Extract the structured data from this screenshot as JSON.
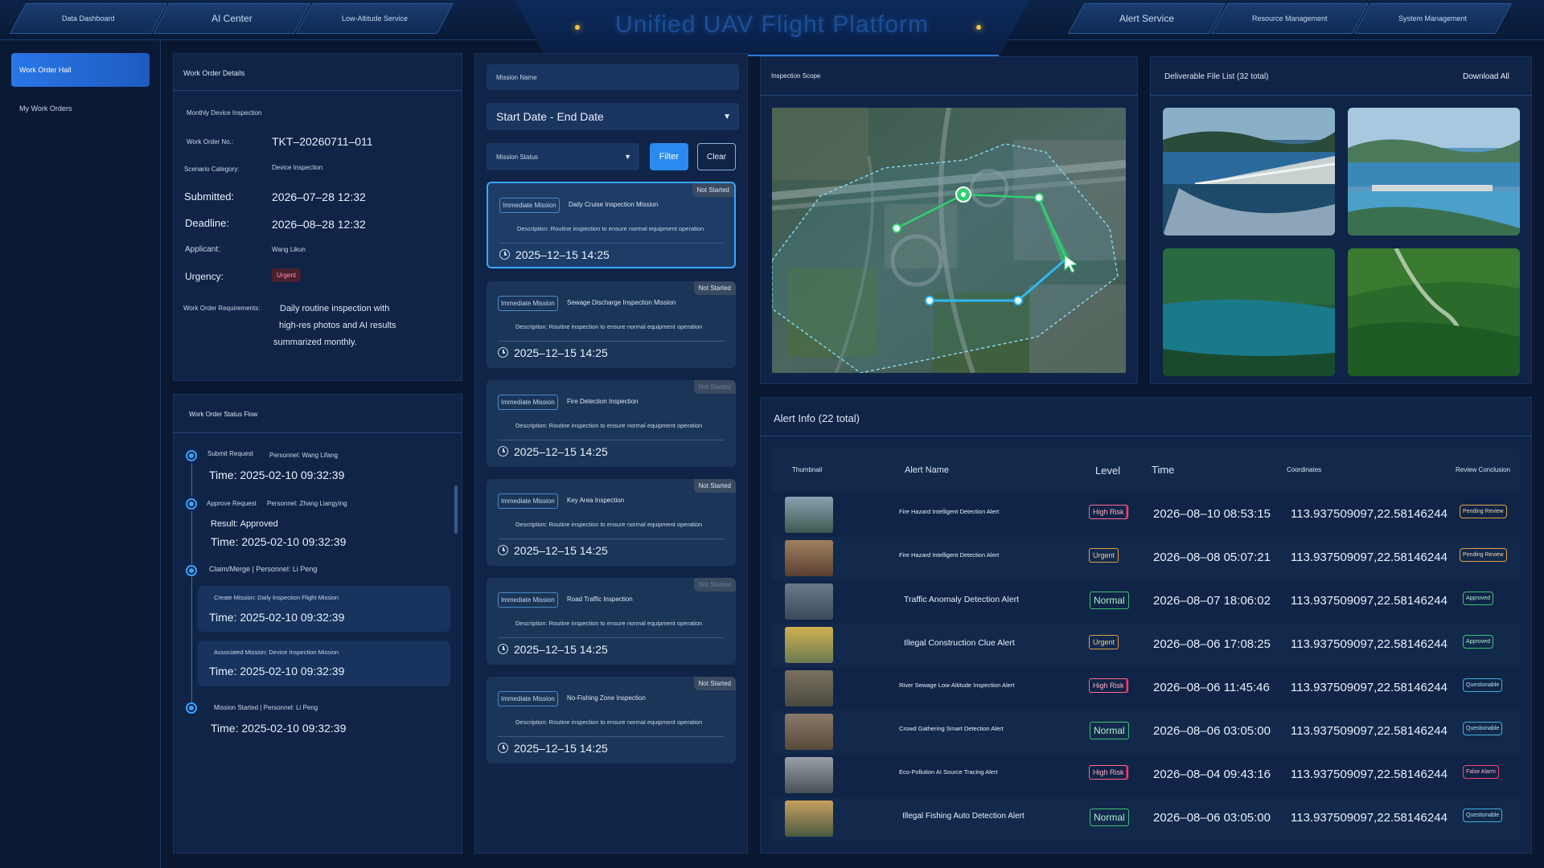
{
  "nav": {
    "left_tabs": [
      "Data Dashboard",
      "AI Center",
      "Low-Altitude Service"
    ],
    "right_tabs": [
      "Alert Service",
      "Resource Management",
      "System Management"
    ],
    "title": "Unified UAV Flight Platform"
  },
  "sidebar": {
    "items": [
      {
        "label": "Work Order Hall",
        "active": true
      },
      {
        "label": "My Work Orders",
        "active": false
      }
    ]
  },
  "work_order": {
    "panel_title": "Work Order Details",
    "name": "Monthly Device Inspection",
    "number_label": "Work Order No.:",
    "number": "TKT–20260711–011",
    "scenario_label": "Scenario Category:",
    "scenario": "Device Inspection",
    "submitted_label": "Submitted:",
    "submitted": "2026–07–28 12:32",
    "deadline_label": "Deadline:",
    "deadline": "2026–08–28 12:32",
    "applicant_label": "Applicant:",
    "applicant": "Wang Likun",
    "urgency_label": "Urgency:",
    "urgency": "Urgent",
    "requirements_label": "Work Order Requirements:",
    "requirements_lines": [
      "Daily routine inspection with",
      "high-res photos and AI results",
      "summarized monthly."
    ]
  },
  "status_flow": {
    "panel_title": "Work Order Status Flow",
    "steps": [
      {
        "title": "Submit Request",
        "personnel": "Personnel: Wang Lifang",
        "time": "Time: 2025-02-10 09:32:39"
      },
      {
        "title": "Approve Request",
        "personnel": "Personnel: Zhang Liangying",
        "result": "Result: Approved",
        "time": "Time: 2025-02-10 09:32:39"
      },
      {
        "title": "Claim/Merge | Personnel: Li Peng",
        "sub": [
          {
            "title": "Create Mission: Daily Inspection Flight Mission",
            "time": "Time: 2025-02-10 09:32:39"
          },
          {
            "title": "Associated Mission: Device Inspection Mission",
            "time": "Time: 2025-02-10 09:32:39"
          }
        ]
      },
      {
        "title": "Mission Started | Personnel: Li Peng",
        "time": "Time: 2025-02-10 09:32:39"
      }
    ]
  },
  "mission_filter": {
    "name_placeholder": "Mission Name",
    "date_range": "Start Date - End Date",
    "status_placeholder": "Mission Status",
    "filter_label": "Filter",
    "clear_label": "Clear"
  },
  "missions": [
    {
      "type": "Immediate Mission",
      "name": "Daily Cruise Inspection Mission",
      "status": "Not Started",
      "desc": "Description: Routine inspection to ensure normal equipment operation",
      "date": "2025–12–15 14:25",
      "active": true
    },
    {
      "type": "Immediate Mission",
      "name": "Sewage Discharge Inspection Mission",
      "status": "Not Started",
      "desc": "Description: Routine inspection to ensure normal equipment operation",
      "date": "2025–12–15 14:25"
    },
    {
      "type": "Immediate Mission",
      "name": "Fire Detection Inspection",
      "status": "Not Started",
      "desc": "Description: Routine inspection to ensure normal equipment operation",
      "date": "2025–12–15 14:25",
      "dim": true
    },
    {
      "type": "Immediate Mission",
      "name": "Key Area Inspection",
      "status": "Not Started",
      "desc": "Description: Routine inspection to ensure normal equipment operation",
      "date": "2025–12–15 14:25"
    },
    {
      "type": "Immediate Mission",
      "name": "Road Traffic Inspection",
      "status": "Not Started",
      "desc": "Description: Routine inspection to ensure normal equipment operation",
      "date": "2025–12–15 14:25",
      "dim": true
    },
    {
      "type": "Immediate Mission",
      "name": "No-Fishing Zone Inspection",
      "status": "Not Started",
      "desc": "Description: Routine inspection to ensure normal equipment operation",
      "date": "2025–12–15 14:25"
    }
  ],
  "inspection": {
    "title": "Inspection Scope"
  },
  "deliverables": {
    "title": "Deliverable File List (32 total)",
    "download_label": "Download All",
    "images": [
      "dam-spillway-photo",
      "reservoir-dam-photo",
      "forest-lake-photo",
      "forest-river-photo"
    ]
  },
  "alerts": {
    "title": "Alert Info (22 total)",
    "columns": [
      "Thumbnail",
      "Alert Name",
      "Level",
      "Time",
      "Coordinates",
      "Review Conclusion"
    ],
    "rows": [
      {
        "name": "Fire Hazard Intelligent Detection Alert",
        "level": "High Risk",
        "level_type": "high",
        "time": "2026–08–10 08:53:15",
        "coords": "113.937509097,22.58146244",
        "review": "Pending Review",
        "review_type": "pend"
      },
      {
        "name": "Fire Hazard Intelligent Detection Alert",
        "level": "Urgent",
        "level_type": "urg",
        "time": "2026–08–08 05:07:21",
        "coords": "113.937509097,22.58146244",
        "review": "Pending Review",
        "review_type": "pend"
      },
      {
        "name": "Traffic Anomaly Detection Alert",
        "level": "Normal",
        "level_type": "norm",
        "time": "2026–08–07 18:06:02",
        "coords": "113.937509097,22.58146244",
        "review": "Approved",
        "review_type": "appr"
      },
      {
        "name": "Illegal Construction Clue Alert",
        "level": "Urgent",
        "level_type": "urg",
        "time": "2026–08–06 17:08:25",
        "coords": "113.937509097,22.58146244",
        "review": "Approved",
        "review_type": "appr"
      },
      {
        "name": "River Sewage Low-Altitude Inspection Alert",
        "level": "High Risk",
        "level_type": "high",
        "time": "2026–08–06 11:45:46",
        "coords": "113.937509097,22.58146244",
        "review": "Questionable",
        "review_type": "ques"
      },
      {
        "name": "Crowd Gathering Smart Detection Alert",
        "level": "Normal",
        "level_type": "norm",
        "time": "2026–08–06 03:05:00",
        "coords": "113.937509097,22.58146244",
        "review": "Questionable",
        "review_type": "ques"
      },
      {
        "name": "Eco-Pollution AI Source Tracing Alert",
        "level": "High Risk",
        "level_type": "high",
        "time": "2026–08–04 09:43:16",
        "coords": "113.937509097,22.58146244",
        "review": "False Alarm",
        "review_type": "fals"
      },
      {
        "name": "Illegal Fishing Auto Detection Alert",
        "level": "Normal",
        "level_type": "norm",
        "time": "2026–08–06 03:05:00",
        "coords": "113.937509097,22.58146244",
        "review": "Questionable",
        "review_type": "ques"
      }
    ]
  }
}
